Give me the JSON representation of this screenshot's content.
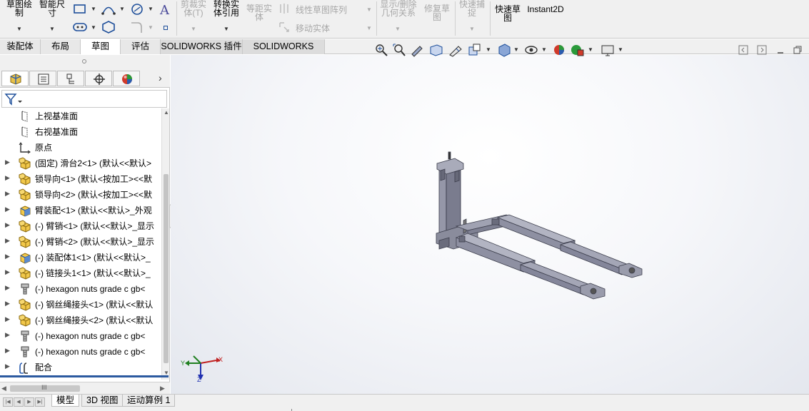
{
  "ribbon": {
    "sketch_label": "草图绘\n制",
    "smart_dim_label": "智能尺\n寸",
    "trim_label": "剪裁实\n体(T)",
    "convert_label": "转换实\n体引用",
    "offset_label": "等距实\n体",
    "linear_pattern_label": "线性草图阵列",
    "move_entities_label": "移动实体",
    "display_relations_label": "显示/删除\n几何关系",
    "repair_label": "修复草\n图",
    "quick_snaps_label": "快速捕\n捉",
    "rapid_sketch_label": "快速草\n图",
    "instant2d_label": "Instant2D"
  },
  "command_tabs": [
    "装配体",
    "布局",
    "草图",
    "评估",
    "SOLIDWORKS 插件",
    "SOLIDWORKS MBD"
  ],
  "active_command_tab": "草图",
  "tree": {
    "items": [
      {
        "label": "上视基准面",
        "icon": "plane-icon",
        "expandable": false
      },
      {
        "label": "右视基准面",
        "icon": "plane-icon",
        "expandable": false
      },
      {
        "label": "原点",
        "icon": "origin-icon",
        "expandable": false
      },
      {
        "label": "(固定) 滑台2<1> (默认<<默认>",
        "icon": "part-icon",
        "expandable": true
      },
      {
        "label": "锁导向<1> (默认<按加工><<默",
        "icon": "part-icon",
        "expandable": true
      },
      {
        "label": "锁导向<2> (默认<按加工><<默",
        "icon": "part-icon",
        "expandable": true
      },
      {
        "label": "臂装配<1> (默认<<默认>_外观",
        "icon": "subassembly-icon",
        "expandable": true
      },
      {
        "label": "(-) 臂销<1> (默认<<默认>_显示",
        "icon": "part-icon",
        "expandable": true
      },
      {
        "label": "(-) 臂销<2> (默认<<默认>_显示",
        "icon": "part-icon",
        "expandable": true
      },
      {
        "label": "(-) 装配体1<1> (默认<<默认>_",
        "icon": "subassembly-icon",
        "expandable": true
      },
      {
        "label": "(-) 链接头1<1> (默认<<默认>_",
        "icon": "part-icon",
        "expandable": true
      },
      {
        "label": "(-) hexagon nuts grade c gb<",
        "icon": "bolt-icon",
        "expandable": true
      },
      {
        "label": "(-) 钢丝绳接头<1> (默认<<默认",
        "icon": "part-icon",
        "expandable": true
      },
      {
        "label": "(-) 钢丝绳接头<2> (默认<<默认",
        "icon": "part-icon",
        "expandable": true
      },
      {
        "label": "(-) hexagon nuts grade c gb<",
        "icon": "bolt-icon",
        "expandable": true
      },
      {
        "label": "(-) hexagon nuts grade c gb<",
        "icon": "bolt-icon",
        "expandable": true
      },
      {
        "label": "配合",
        "icon": "mates-icon",
        "expandable": true
      }
    ]
  },
  "hscroll_label": "III",
  "bottom_tabs": [
    "模型",
    "3D 视图",
    "运动算例 1"
  ],
  "active_bottom_tab": "模型",
  "triad": {
    "x": "X",
    "y": "Y",
    "z": "Z"
  },
  "colors": {
    "model": "#8c8ea0",
    "accent": "#2c5aa0"
  }
}
